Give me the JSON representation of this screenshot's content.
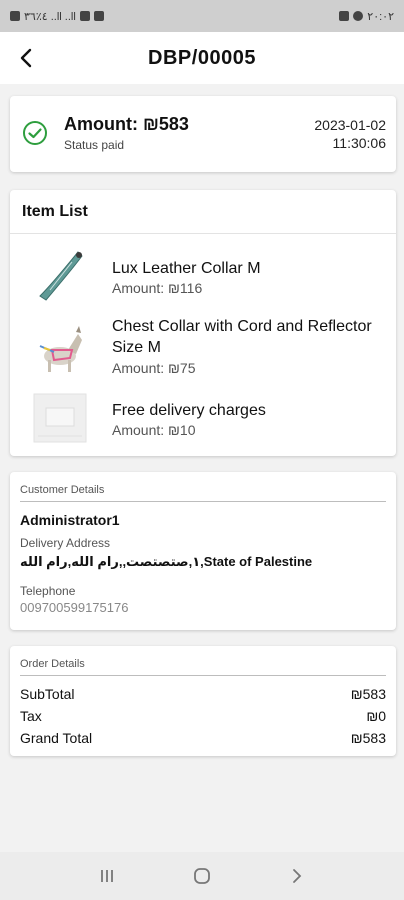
{
  "status_bar": {
    "left_text": "٤٪٣٦ ..ll ..ll",
    "right_text": "٢٠:٠٢"
  },
  "app_bar": {
    "title": "DBP/00005",
    "back_icon": "arrow-left-icon"
  },
  "payment": {
    "amount_label": "Amount: ₪583",
    "status": "Status paid",
    "date": "2023-01-02",
    "time": "11:30:06",
    "status_color": "#2e9e3e"
  },
  "items": {
    "header": "Item List",
    "list": [
      {
        "name": "Lux Leather Collar M",
        "amount": "Amount: ₪116",
        "image": "leather-collar-image"
      },
      {
        "name": "Chest Collar with Cord and Reflector Size M",
        "amount": "Amount: ₪75",
        "image": "dog-harness-image"
      },
      {
        "name": "Free delivery charges",
        "amount": "Amount: ₪10",
        "image": "delivery-placeholder-image"
      }
    ]
  },
  "customer": {
    "section_label": "Customer Details",
    "name": "Administrator1",
    "address_label": "Delivery Address",
    "address": "١,صتصتصت,,رام الله,رام الله,State of Palestine",
    "telephone_label": "Telephone",
    "telephone": "009700599175176"
  },
  "order": {
    "section_label": "Order Details",
    "rows": [
      {
        "label": "SubTotal",
        "value": "₪583"
      },
      {
        "label": "Tax",
        "value": "₪0"
      },
      {
        "label": "Grand Total",
        "value": "₪583"
      }
    ]
  }
}
